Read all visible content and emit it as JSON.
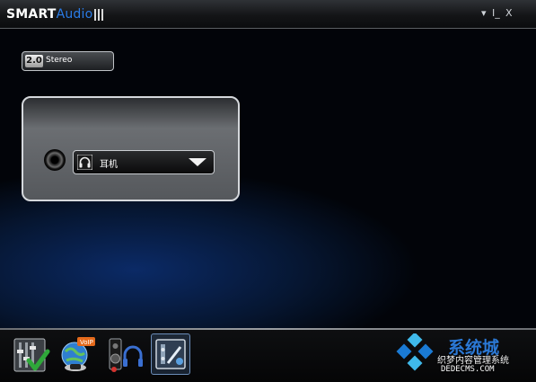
{
  "titlebar": {
    "brand_part1": "SMART",
    "brand_part2": "Audio",
    "menu_glyph": "▾",
    "minimize_glyph": "I_",
    "close_glyph": "X"
  },
  "mode": {
    "badge": "2.0",
    "label": "Stereo"
  },
  "device": {
    "selected": "耳机"
  },
  "toolbar": {
    "tools": [
      {
        "icon": "equalizer-check-icon"
      },
      {
        "icon": "voip-globe-icon"
      },
      {
        "icon": "speaker-headphone-icon"
      },
      {
        "icon": "audio-director-icon"
      }
    ]
  },
  "watermark": {
    "title": "系统城",
    "subtitle": "织梦内容管理系统",
    "url": "DEDECMS.COM",
    "colors": {
      "logo_blue": "#1a7ad4",
      "logo_cyan": "#3fb9ea"
    }
  }
}
